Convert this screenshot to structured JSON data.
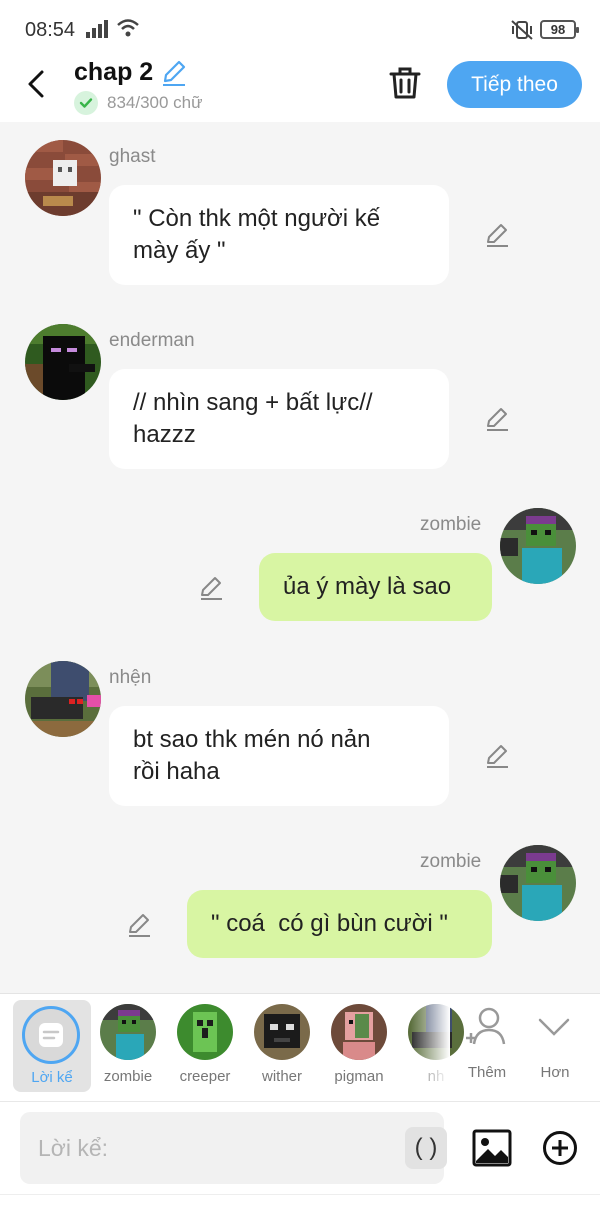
{
  "status_bar": {
    "time": "08:54",
    "battery": "98"
  },
  "header": {
    "title": "chap 2",
    "word_count": "834/300 chữ",
    "next_label": "Tiếp theo"
  },
  "messages": [
    {
      "name": "ghast",
      "side": "left",
      "text_lines": [
        "\" Còn thk một người kế",
        "mày ấy \""
      ]
    },
    {
      "name": "enderman",
      "side": "left",
      "text_lines": [
        "// nhìn sang + bất lực//",
        "hazzz"
      ]
    },
    {
      "name": "zombie",
      "side": "right",
      "text_lines": [
        "ủa ý mày là sao"
      ]
    },
    {
      "name": "nhện",
      "side": "left",
      "text_lines": [
        "bt sao thk mén nó nản",
        "rồi haha"
      ]
    },
    {
      "name": "zombie",
      "side": "right",
      "text_lines": [
        "\" coá  có gì bùn cười \""
      ]
    }
  ],
  "character_bar": {
    "narrator_label": "Lời kể",
    "characters": [
      "zombie",
      "creeper",
      "wither",
      "pigman",
      "nh"
    ],
    "add_label": "Thêm",
    "more_label": "Hơn"
  },
  "input": {
    "placeholder": "Lời kể:",
    "paren_label": "( )"
  },
  "colors": {
    "accent": "#4ea6f2",
    "right_bubble": "#d8f5a3",
    "background": "#f5f5f5"
  }
}
